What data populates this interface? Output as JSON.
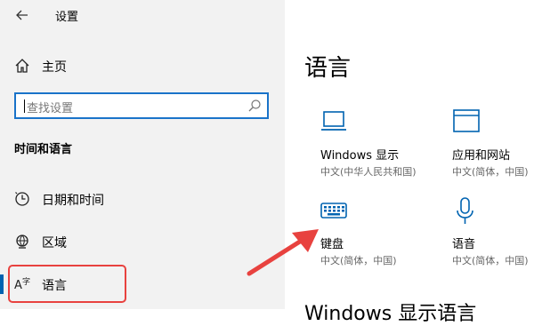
{
  "header": {
    "title": "设置"
  },
  "nav": {
    "home": "主页",
    "section": "时间和语言",
    "items": [
      {
        "label": "日期和时间",
        "icon": "clock-icon"
      },
      {
        "label": "区域",
        "icon": "globe-icon"
      },
      {
        "label": "语言",
        "icon": "language-icon"
      }
    ]
  },
  "search": {
    "placeholder": "查找设置"
  },
  "main": {
    "title": "语言",
    "tiles": [
      {
        "title": "Windows 显示",
        "subtitle": "中文(中华人民共和国)",
        "icon": "monitor-icon"
      },
      {
        "title": "应用和网站",
        "subtitle": "中文(简体，中国)",
        "icon": "window-icon"
      },
      {
        "title": "键盘",
        "subtitle": "中文(简体，中国)",
        "icon": "keyboard-icon"
      },
      {
        "title": "语音",
        "subtitle": "中文(简体，中国)",
        "icon": "microphone-icon"
      }
    ],
    "next_heading": "Windows 显示语言"
  },
  "colors": {
    "accent": "#0063b1",
    "annotation": "#e8423f",
    "sidebar_bg": "#f2f2f2"
  }
}
